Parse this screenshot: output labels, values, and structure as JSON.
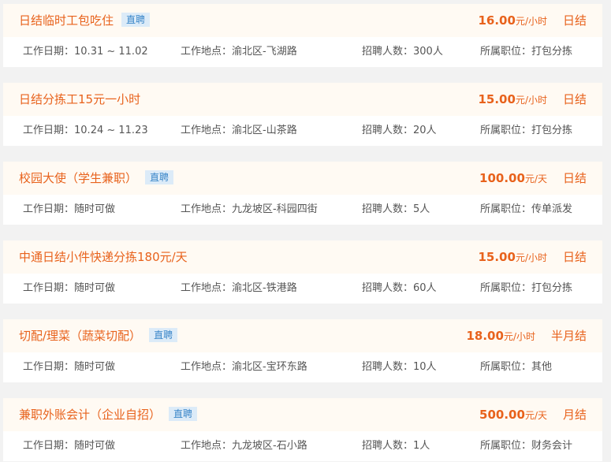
{
  "labels": {
    "date": "工作日期：",
    "location": "工作地点：",
    "count": "招聘人数：",
    "position": "所属职位："
  },
  "colors": {
    "accent": "#e8621c",
    "badge_text": "#3a86c8",
    "badge_bg": "#dcebf8",
    "header_bg": "#fffaf3"
  },
  "jobs": [
    {
      "title": "日结临时工包吃住",
      "badge": "直聘",
      "price": "16.00",
      "unit": "元/小时",
      "settle": "日结",
      "date": "10.31 ~ 11.02",
      "location": "渝北区-飞湖路",
      "count": "300人",
      "position": "打包分拣"
    },
    {
      "title": "日结分拣工15元一小时",
      "badge": "",
      "price": "15.00",
      "unit": "元/小时",
      "settle": "日结",
      "date": "10.24 ~ 11.23",
      "location": "渝北区-山茶路",
      "count": "20人",
      "position": "打包分拣"
    },
    {
      "title": "校园大使（学生兼职）",
      "badge": "直聘",
      "price": "100.00",
      "unit": "元/天",
      "settle": "日结",
      "date": "随时可做",
      "location": "九龙坡区-科园四街",
      "count": "5人",
      "position": "传单派发"
    },
    {
      "title": "中通日结小件快递分拣180元/天",
      "badge": "",
      "price": "15.00",
      "unit": "元/小时",
      "settle": "日结",
      "date": "随时可做",
      "location": "渝北区-铁港路",
      "count": "60人",
      "position": "打包分拣"
    },
    {
      "title": "切配/理菜（蔬菜切配）",
      "badge": "直聘",
      "price": "18.00",
      "unit": "元/小时",
      "settle": "半月结",
      "date": "随时可做",
      "location": "渝北区-宝环东路",
      "count": "10人",
      "position": "其他"
    },
    {
      "title": "兼职外账会计（企业自招）",
      "badge": "直聘",
      "price": "500.00",
      "unit": "元/天",
      "settle": "月结",
      "date": "随时可做",
      "location": "九龙坡区-石小路",
      "count": "1人",
      "position": "财务会计"
    }
  ]
}
